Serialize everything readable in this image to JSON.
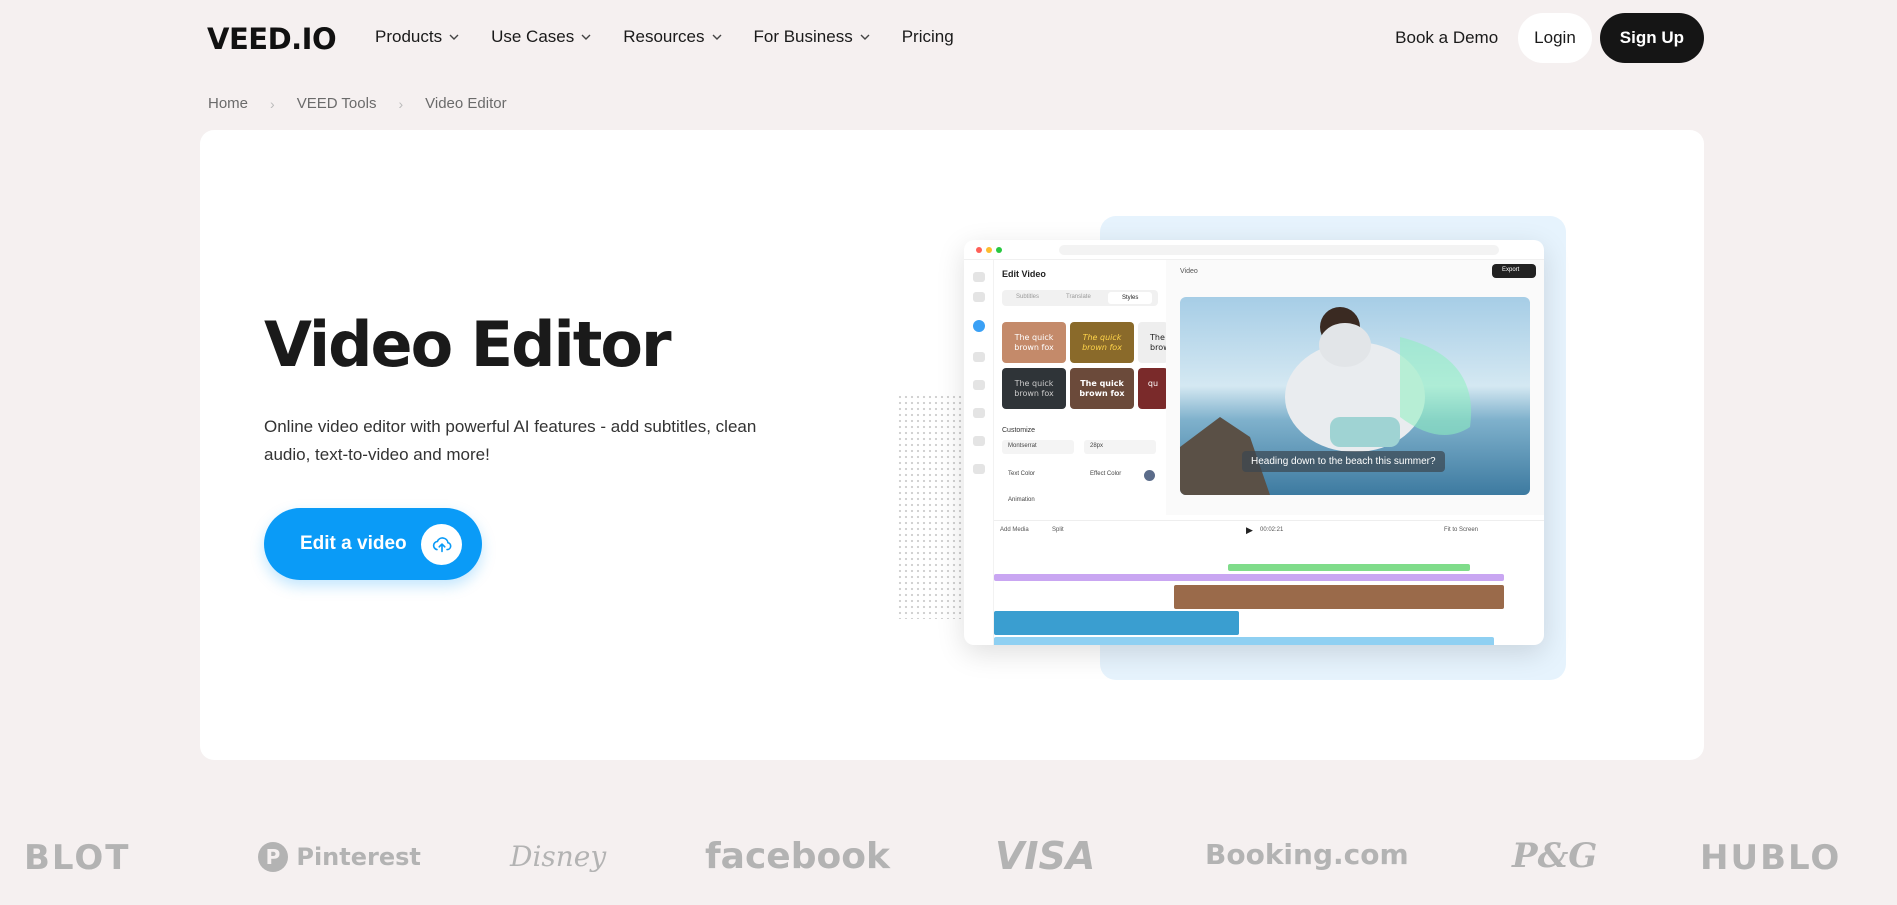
{
  "nav": {
    "logo": "VEED.IO",
    "items": [
      {
        "label": "Products",
        "has_dropdown": true
      },
      {
        "label": "Use Cases",
        "has_dropdown": true
      },
      {
        "label": "Resources",
        "has_dropdown": true
      },
      {
        "label": "For Business",
        "has_dropdown": true
      },
      {
        "label": "Pricing",
        "has_dropdown": false
      }
    ],
    "book_demo": "Book a Demo",
    "login": "Login",
    "signup": "Sign Up"
  },
  "breadcrumb": [
    "Home",
    "VEED Tools",
    "Video Editor"
  ],
  "hero": {
    "title": "Video Editor",
    "description": "Online video editor with powerful AI features - add subtitles, clean audio, text-to-video and more!",
    "cta_label": "Edit a video",
    "cta_icon": "upload-cloud-icon"
  },
  "mockup": {
    "panel_title": "Edit Video",
    "tabs": [
      "Subtitles",
      "Translate",
      "Styles"
    ],
    "active_tab": "Styles",
    "tiles": [
      "The quick brown fox",
      "The quick brown fox",
      "The brow",
      "The quick brown fox",
      "The quick brown fox",
      "qu"
    ],
    "customize_label": "Customize",
    "font_value": "Montserrat",
    "size_value": "28px",
    "text_color_label": "Text Color",
    "effect_color_label": "Effect Color",
    "animation_label": "Animation",
    "video_label": "Video",
    "export_label": "Export",
    "subtitle_text": "Heading down to the beach this summer?",
    "timecode": "00:02:21",
    "split_label": "Split",
    "add_media_label": "Add Media",
    "fit_label": "Fit to Screen"
  },
  "logos": [
    "BLOT",
    "Pinterest",
    "Disney",
    "facebook",
    "VISA",
    "Booking.com",
    "P&G",
    "HUBLO"
  ],
  "colors": {
    "accent": "#0a9bf7",
    "dark": "#151515",
    "page_bg": "#f5f0f0",
    "logo_gray": "#b3b3b3"
  }
}
